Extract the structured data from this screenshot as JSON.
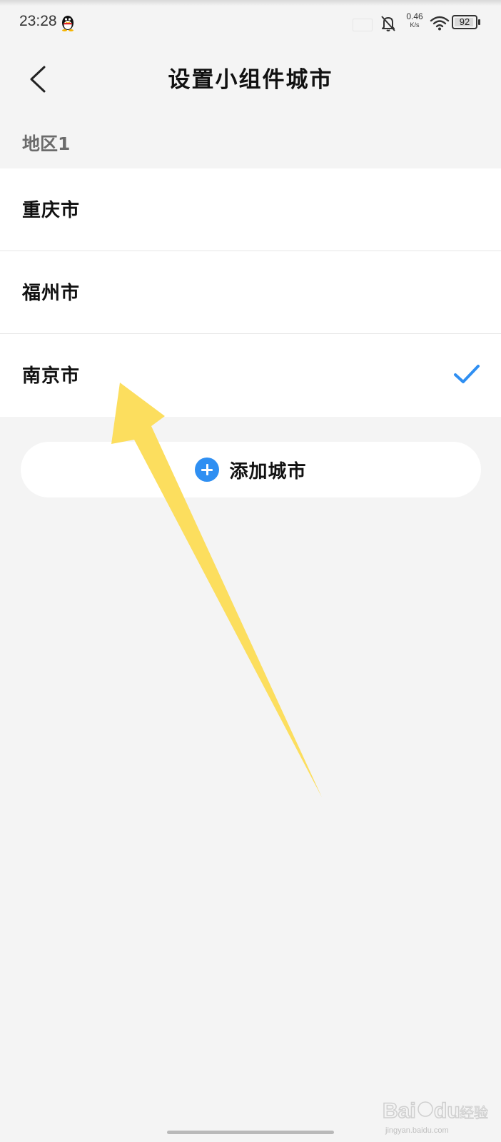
{
  "status_bar": {
    "time": "23:28",
    "speed_value": "0.46",
    "speed_unit": "K/s",
    "battery": "92",
    "battery_fraction": 0.92
  },
  "header": {
    "title": "设置小组件城市"
  },
  "section": {
    "label": "地区1"
  },
  "cities": [
    {
      "name": "重庆市",
      "selected": false
    },
    {
      "name": "福州市",
      "selected": false
    },
    {
      "name": "南京市",
      "selected": true
    }
  ],
  "add_button": {
    "label": "添加城市"
  },
  "icons": {
    "back": "chevron-left-icon",
    "check": "checkmark-icon",
    "add": "plus-circle-icon",
    "notification": "bell-off-icon",
    "wifi": "wifi-icon",
    "battery": "battery-icon",
    "app": "qq-penguin-icon"
  },
  "colors": {
    "background": "#f4f4f4",
    "card": "#ffffff",
    "accent": "#2f8ff2",
    "annotation_arrow": "#fcdc55"
  },
  "watermark": {
    "logo": "Baidu经验",
    "url": "jingyan.baidu.com"
  }
}
